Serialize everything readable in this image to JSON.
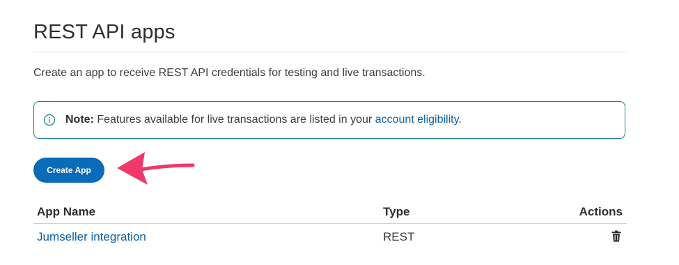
{
  "header": {
    "title": "REST API apps"
  },
  "description": "Create an app to receive REST API credentials for testing and live transactions.",
  "note": {
    "icon": "info-icon",
    "label": "Note:",
    "text_before": " Features available for live transactions are listed in your ",
    "link": "account eligibility",
    "text_after": "."
  },
  "create_button": {
    "label": "Create App"
  },
  "annotation": {
    "icon": "pointer-arrow",
    "color": "#f0386b"
  },
  "table": {
    "columns": {
      "name": "App Name",
      "type": "Type",
      "actions": "Actions"
    },
    "rows": [
      {
        "name": "Jumseller integration",
        "type": "REST",
        "action_icon": "trash-icon"
      }
    ]
  },
  "colors": {
    "accent": "#0a6bb8",
    "link": "#0b61a4",
    "note_border": "#1a7c8b"
  }
}
